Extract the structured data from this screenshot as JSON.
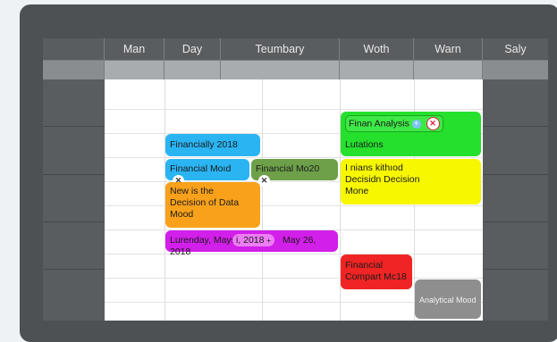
{
  "columns": [
    "Man",
    "Day",
    "Teumbary",
    "Woth",
    "Warn",
    "Saly"
  ],
  "events": {
    "finan_analysis": "Finan Analysis",
    "lutations": "Lutations",
    "financially": "Financially 2018",
    "financial_mod": "Financial Moıd",
    "financial_mo20": "Financial Mo20",
    "nians_line1": "I nians kithıod",
    "nians_line2": "Decisidn Decision",
    "nians_line3": "Mone",
    "new_line1": "New is the",
    "new_line2": "Decision of Data",
    "new_line3": "Mood",
    "lurenday_left": "Lurenday, Mays",
    "lurenday_chip": "i, 2018",
    "lurenday_right": "May 26, 2018",
    "financial_compart_line1": "Financial",
    "financial_compart_line2": "Compart Mc18",
    "analytical_mood": "Analytical Mood"
  },
  "colors": {
    "blue": "#2ab4f2",
    "green": "#25e02d",
    "olive": "#6da049",
    "yellow": "#f7f700",
    "orange": "#f9a11b",
    "magenta": "#d21fe9",
    "red": "#f02424",
    "gray": "#8e8e8e"
  },
  "icons": [
    "close-icon",
    "plus-icon"
  ]
}
